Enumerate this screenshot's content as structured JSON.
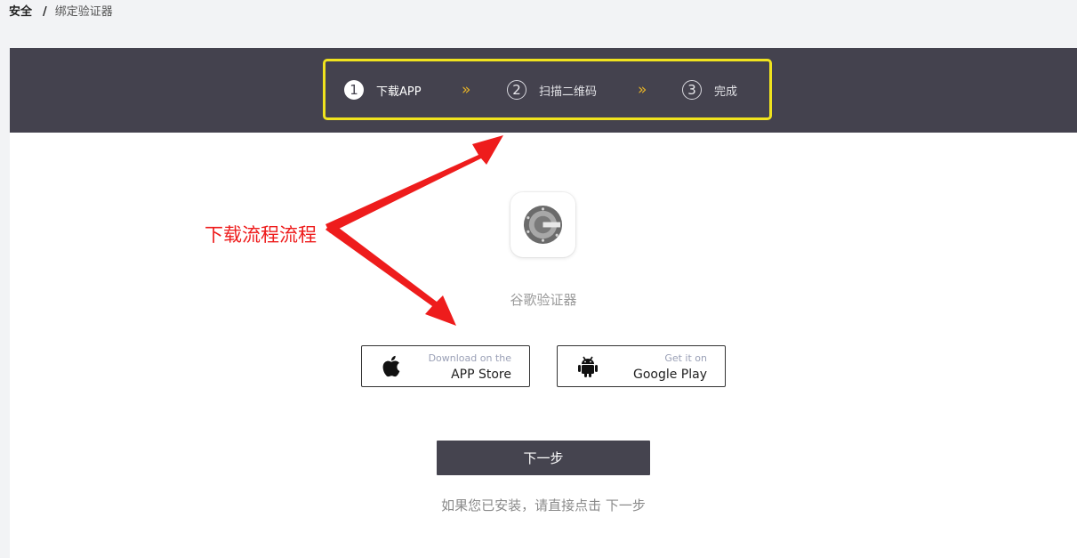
{
  "breadcrumb": {
    "root": "安全",
    "separator": "/",
    "current": "绑定验证器"
  },
  "steps": [
    {
      "number": "1",
      "label": "下载APP",
      "state": "active"
    },
    {
      "number": "2",
      "label": "扫描二维码",
      "state": "pending"
    },
    {
      "number": "3",
      "label": "完成",
      "state": "pending"
    }
  ],
  "step_arrow": "»",
  "app": {
    "icon": "google-authenticator-icon",
    "name": "谷歌验证器"
  },
  "stores": {
    "apple": {
      "small": "Download on the",
      "big": "APP Store",
      "icon": "apple-icon"
    },
    "google": {
      "small": "Get it on",
      "big": "Google Play",
      "icon": "android-icon"
    }
  },
  "next_button": "下一步",
  "hint": "如果您已安装，请直接点击 下一步",
  "annotation": {
    "text": "下载流程流程",
    "color": "#ee1c1c"
  },
  "colors": {
    "header_bg": "#44424e",
    "highlight_border": "#f0e31e",
    "arrow_accent": "#e8b426",
    "primary_button": "#45444f"
  }
}
